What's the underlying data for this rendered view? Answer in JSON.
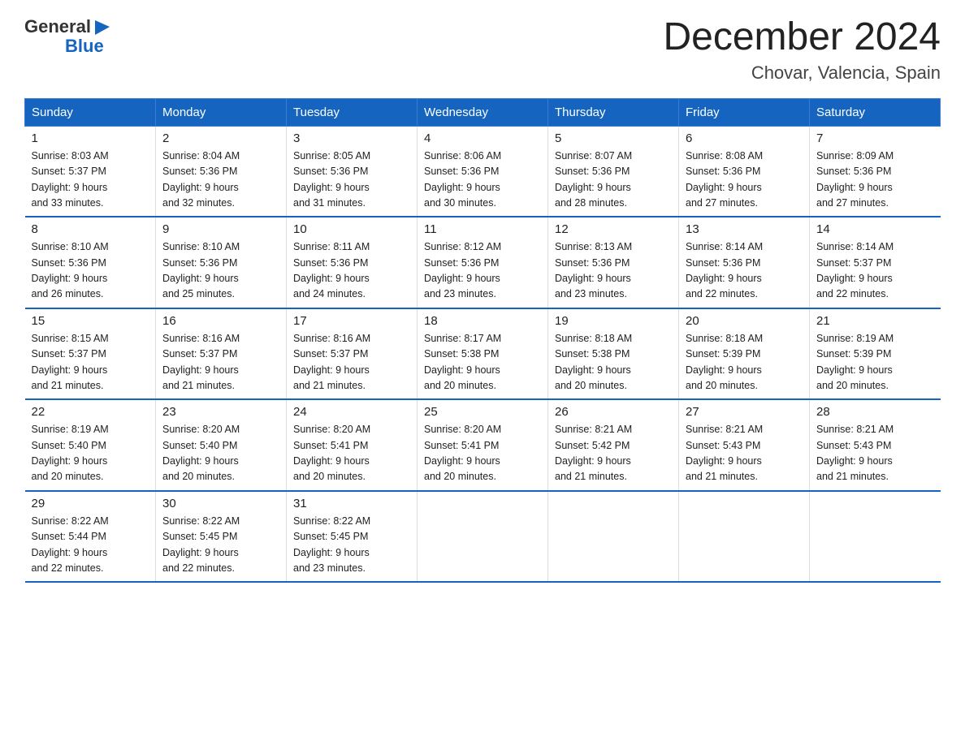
{
  "header": {
    "logo_general": "General",
    "logo_blue": "Blue",
    "month_title": "December 2024",
    "location": "Chovar, Valencia, Spain"
  },
  "days_of_week": [
    "Sunday",
    "Monday",
    "Tuesday",
    "Wednesday",
    "Thursday",
    "Friday",
    "Saturday"
  ],
  "weeks": [
    [
      {
        "num": "1",
        "sunrise": "8:03 AM",
        "sunset": "5:37 PM",
        "daylight": "9 hours and 33 minutes."
      },
      {
        "num": "2",
        "sunrise": "8:04 AM",
        "sunset": "5:36 PM",
        "daylight": "9 hours and 32 minutes."
      },
      {
        "num": "3",
        "sunrise": "8:05 AM",
        "sunset": "5:36 PM",
        "daylight": "9 hours and 31 minutes."
      },
      {
        "num": "4",
        "sunrise": "8:06 AM",
        "sunset": "5:36 PM",
        "daylight": "9 hours and 30 minutes."
      },
      {
        "num": "5",
        "sunrise": "8:07 AM",
        "sunset": "5:36 PM",
        "daylight": "9 hours and 28 minutes."
      },
      {
        "num": "6",
        "sunrise": "8:08 AM",
        "sunset": "5:36 PM",
        "daylight": "9 hours and 27 minutes."
      },
      {
        "num": "7",
        "sunrise": "8:09 AM",
        "sunset": "5:36 PM",
        "daylight": "9 hours and 27 minutes."
      }
    ],
    [
      {
        "num": "8",
        "sunrise": "8:10 AM",
        "sunset": "5:36 PM",
        "daylight": "9 hours and 26 minutes."
      },
      {
        "num": "9",
        "sunrise": "8:10 AM",
        "sunset": "5:36 PM",
        "daylight": "9 hours and 25 minutes."
      },
      {
        "num": "10",
        "sunrise": "8:11 AM",
        "sunset": "5:36 PM",
        "daylight": "9 hours and 24 minutes."
      },
      {
        "num": "11",
        "sunrise": "8:12 AM",
        "sunset": "5:36 PM",
        "daylight": "9 hours and 23 minutes."
      },
      {
        "num": "12",
        "sunrise": "8:13 AM",
        "sunset": "5:36 PM",
        "daylight": "9 hours and 23 minutes."
      },
      {
        "num": "13",
        "sunrise": "8:14 AM",
        "sunset": "5:36 PM",
        "daylight": "9 hours and 22 minutes."
      },
      {
        "num": "14",
        "sunrise": "8:14 AM",
        "sunset": "5:37 PM",
        "daylight": "9 hours and 22 minutes."
      }
    ],
    [
      {
        "num": "15",
        "sunrise": "8:15 AM",
        "sunset": "5:37 PM",
        "daylight": "9 hours and 21 minutes."
      },
      {
        "num": "16",
        "sunrise": "8:16 AM",
        "sunset": "5:37 PM",
        "daylight": "9 hours and 21 minutes."
      },
      {
        "num": "17",
        "sunrise": "8:16 AM",
        "sunset": "5:37 PM",
        "daylight": "9 hours and 21 minutes."
      },
      {
        "num": "18",
        "sunrise": "8:17 AM",
        "sunset": "5:38 PM",
        "daylight": "9 hours and 20 minutes."
      },
      {
        "num": "19",
        "sunrise": "8:18 AM",
        "sunset": "5:38 PM",
        "daylight": "9 hours and 20 minutes."
      },
      {
        "num": "20",
        "sunrise": "8:18 AM",
        "sunset": "5:39 PM",
        "daylight": "9 hours and 20 minutes."
      },
      {
        "num": "21",
        "sunrise": "8:19 AM",
        "sunset": "5:39 PM",
        "daylight": "9 hours and 20 minutes."
      }
    ],
    [
      {
        "num": "22",
        "sunrise": "8:19 AM",
        "sunset": "5:40 PM",
        "daylight": "9 hours and 20 minutes."
      },
      {
        "num": "23",
        "sunrise": "8:20 AM",
        "sunset": "5:40 PM",
        "daylight": "9 hours and 20 minutes."
      },
      {
        "num": "24",
        "sunrise": "8:20 AM",
        "sunset": "5:41 PM",
        "daylight": "9 hours and 20 minutes."
      },
      {
        "num": "25",
        "sunrise": "8:20 AM",
        "sunset": "5:41 PM",
        "daylight": "9 hours and 20 minutes."
      },
      {
        "num": "26",
        "sunrise": "8:21 AM",
        "sunset": "5:42 PM",
        "daylight": "9 hours and 21 minutes."
      },
      {
        "num": "27",
        "sunrise": "8:21 AM",
        "sunset": "5:43 PM",
        "daylight": "9 hours and 21 minutes."
      },
      {
        "num": "28",
        "sunrise": "8:21 AM",
        "sunset": "5:43 PM",
        "daylight": "9 hours and 21 minutes."
      }
    ],
    [
      {
        "num": "29",
        "sunrise": "8:22 AM",
        "sunset": "5:44 PM",
        "daylight": "9 hours and 22 minutes."
      },
      {
        "num": "30",
        "sunrise": "8:22 AM",
        "sunset": "5:45 PM",
        "daylight": "9 hours and 22 minutes."
      },
      {
        "num": "31",
        "sunrise": "8:22 AM",
        "sunset": "5:45 PM",
        "daylight": "9 hours and 23 minutes."
      },
      null,
      null,
      null,
      null
    ]
  ]
}
